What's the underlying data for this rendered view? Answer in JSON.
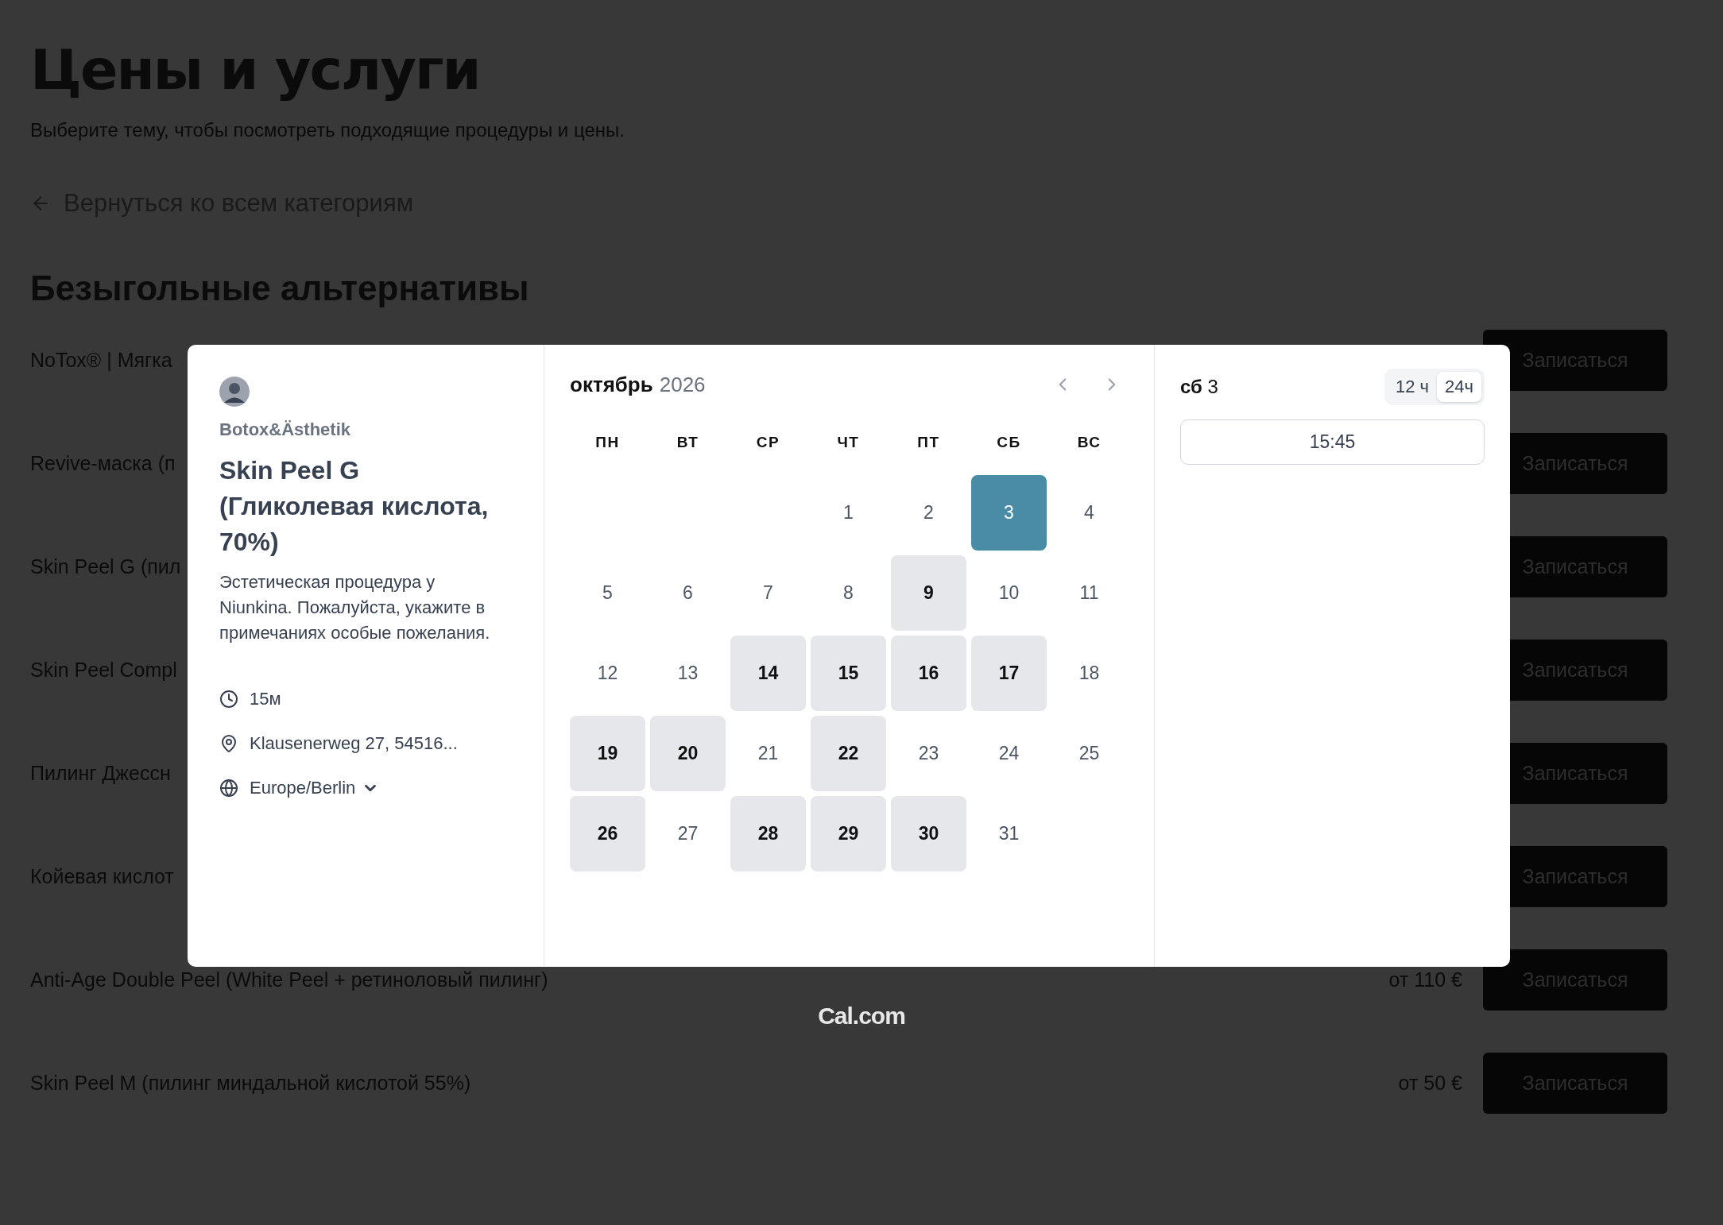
{
  "page": {
    "title": "Цены и услуги",
    "subtitle": "Выберите тему, чтобы посмотреть подходящие процедуры и цены.",
    "back_link": "Вернуться ко всем категориям",
    "section_title": "Безыгольные альтернативы"
  },
  "services": [
    {
      "name": "NoTox® | Мягка",
      "button": "Записаться"
    },
    {
      "name": "Revive-маска (п",
      "button": "Записаться"
    },
    {
      "name": "Skin Peel G (пил",
      "button": "Записаться"
    },
    {
      "name": "Skin Peel Compl",
      "button": "Записаться"
    },
    {
      "name": "Пилинг Джессн",
      "button": "Записаться"
    },
    {
      "name": "Койевая кислот",
      "button": "Записаться"
    },
    {
      "name": "Anti-Age Double Peel (White Peel + ретиноловый пилинг)",
      "price": "от 110 €",
      "button": "Записаться"
    },
    {
      "name": "Skin Peel M (пилинг миндальной кислотой 55%)",
      "price": "от 50 €",
      "button": "Записаться"
    }
  ],
  "booking": {
    "organizer": "Botox&Ästhetik",
    "event_title": "Skin Peel G (Гликолевая кислота, 70%)",
    "description": "Эстетическая процедура у Niunkina. Пожалуйста, укажите в примечаниях особые пожелания.",
    "duration": "15м",
    "location": "Klausenerweg 27, 54516...",
    "timezone": "Europe/Berlin"
  },
  "calendar": {
    "month": "октябрь",
    "year": "2026",
    "weekdays": [
      "ПН",
      "ВТ",
      "СР",
      "ЧТ",
      "ПТ",
      "СБ",
      "ВС"
    ],
    "weeks": [
      {
        "days": [
          {
            "kind": "blank"
          },
          {
            "kind": "blank"
          },
          {
            "kind": "blank"
          },
          {
            "kind": "day",
            "label": "1",
            "available": false,
            "selected": false
          },
          {
            "kind": "day",
            "label": "2",
            "available": false,
            "selected": false
          },
          {
            "kind": "day",
            "label": "3",
            "available": true,
            "selected": true
          },
          {
            "kind": "day",
            "label": "4",
            "available": false,
            "selected": false
          }
        ]
      },
      {
        "days": [
          {
            "kind": "day",
            "label": "5",
            "available": false,
            "selected": false
          },
          {
            "kind": "day",
            "label": "6",
            "available": false,
            "selected": false
          },
          {
            "kind": "day",
            "label": "7",
            "available": false,
            "selected": false
          },
          {
            "kind": "day",
            "label": "8",
            "available": false,
            "selected": false
          },
          {
            "kind": "day",
            "label": "9",
            "available": true,
            "selected": false
          },
          {
            "kind": "day",
            "label": "10",
            "available": false,
            "selected": false
          },
          {
            "kind": "day",
            "label": "11",
            "available": false,
            "selected": false
          }
        ]
      },
      {
        "days": [
          {
            "kind": "day",
            "label": "12",
            "available": false,
            "selected": false
          },
          {
            "kind": "day",
            "label": "13",
            "available": false,
            "selected": false
          },
          {
            "kind": "day",
            "label": "14",
            "available": true,
            "selected": false
          },
          {
            "kind": "day",
            "label": "15",
            "available": true,
            "selected": false
          },
          {
            "kind": "day",
            "label": "16",
            "available": true,
            "selected": false
          },
          {
            "kind": "day",
            "label": "17",
            "available": true,
            "selected": false
          },
          {
            "kind": "day",
            "label": "18",
            "available": false,
            "selected": false
          }
        ]
      },
      {
        "days": [
          {
            "kind": "day",
            "label": "19",
            "available": true,
            "selected": false
          },
          {
            "kind": "day",
            "label": "20",
            "available": true,
            "selected": false
          },
          {
            "kind": "day",
            "label": "21",
            "available": false,
            "selected": false
          },
          {
            "kind": "day",
            "label": "22",
            "available": true,
            "selected": false
          },
          {
            "kind": "day",
            "label": "23",
            "available": false,
            "selected": false
          },
          {
            "kind": "day",
            "label": "24",
            "available": false,
            "selected": false
          },
          {
            "kind": "day",
            "label": "25",
            "available": false,
            "selected": false
          }
        ]
      },
      {
        "days": [
          {
            "kind": "day",
            "label": "26",
            "available": true,
            "selected": false
          },
          {
            "kind": "day",
            "label": "27",
            "available": false,
            "selected": false
          },
          {
            "kind": "day",
            "label": "28",
            "available": true,
            "selected": false
          },
          {
            "kind": "day",
            "label": "29",
            "available": true,
            "selected": false
          },
          {
            "kind": "day",
            "label": "30",
            "available": true,
            "selected": false
          },
          {
            "kind": "day",
            "label": "31",
            "available": false,
            "selected": false
          }
        ]
      }
    ]
  },
  "slots": {
    "weekday": "сб",
    "day": "3",
    "formats": [
      {
        "label": "12 ч",
        "selected": false
      },
      {
        "label": "24ч",
        "selected": true
      }
    ],
    "times": [
      "15:45"
    ]
  },
  "footer": {
    "logo": "Cal.com"
  }
}
